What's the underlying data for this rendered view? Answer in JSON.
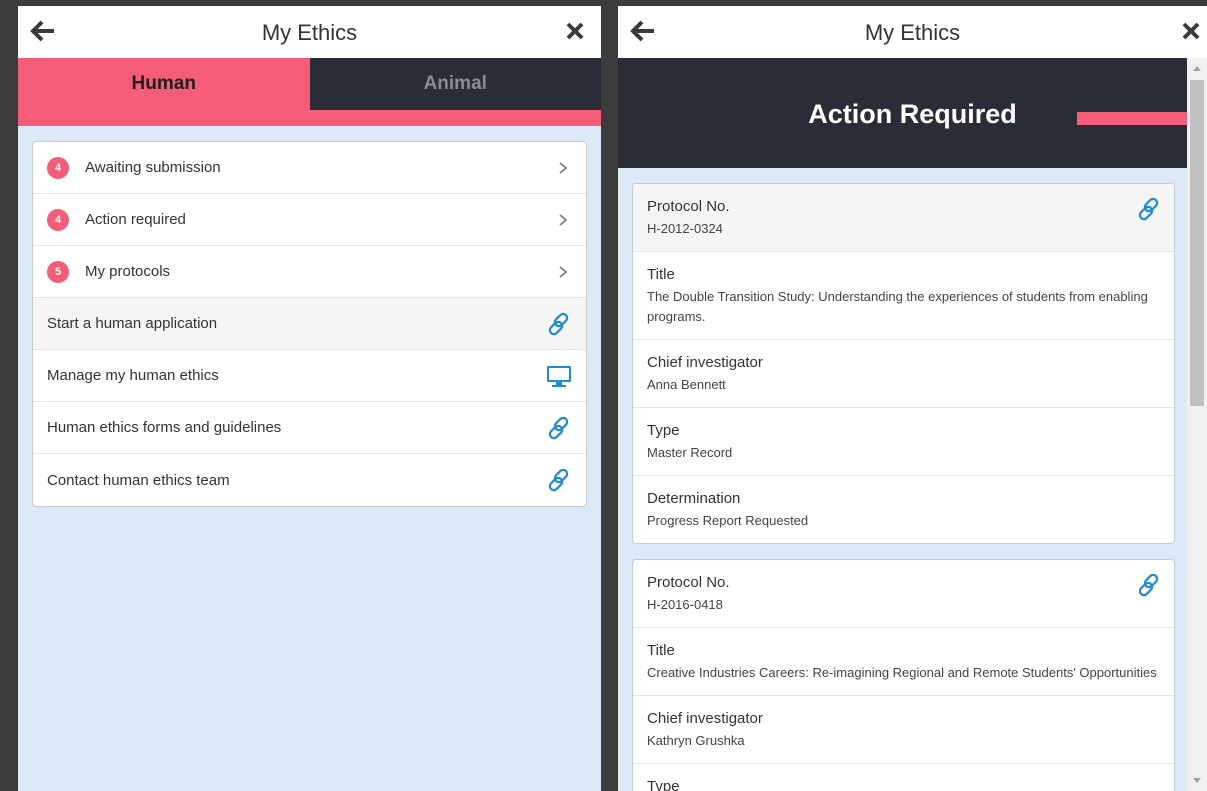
{
  "left": {
    "title": "My Ethics",
    "tabs": [
      {
        "label": "Human",
        "active": true
      },
      {
        "label": "Animal",
        "active": false
      }
    ],
    "menu": [
      {
        "badge": "4",
        "label": "Awaiting submission",
        "icon": "chevron-right-icon"
      },
      {
        "badge": "4",
        "label": "Action required",
        "icon": "chevron-right-icon"
      },
      {
        "badge": "5",
        "label": "My protocols",
        "icon": "chevron-right-icon"
      },
      {
        "badge": null,
        "label": "Start a human application",
        "icon": "link-icon"
      },
      {
        "badge": null,
        "label": "Manage my human ethics",
        "icon": "monitor-icon"
      },
      {
        "badge": null,
        "label": "Human ethics forms and guidelines",
        "icon": "link-icon"
      },
      {
        "badge": null,
        "label": "Contact human ethics team",
        "icon": "link-icon"
      }
    ]
  },
  "right": {
    "title": "My Ethics",
    "heading": "Action Required",
    "protocols": [
      {
        "protocol_label": "Protocol No.",
        "protocol_no": "H-2012-0324",
        "title_label": "Title",
        "title": "The Double Transition Study: Understanding the experiences of students from enabling programs.",
        "ci_label": "Chief investigator",
        "ci": "Anna Bennett",
        "type_label": "Type",
        "type": "Master Record",
        "det_label": "Determination",
        "det": "Progress Report Requested"
      },
      {
        "protocol_label": "Protocol No.",
        "protocol_no": "H-2016-0418",
        "title_label": "Title",
        "title": "Creative Industries Careers: Re-imagining Regional and Remote Students' Opportunities",
        "ci_label": "Chief investigator",
        "ci": "Kathryn Grushka",
        "type_label": "Type"
      }
    ]
  },
  "colors": {
    "accent": "#f45c77",
    "dark": "#2a2d35",
    "page_bg": "#dbeaf6",
    "link_blue": "#1f8ad6"
  }
}
